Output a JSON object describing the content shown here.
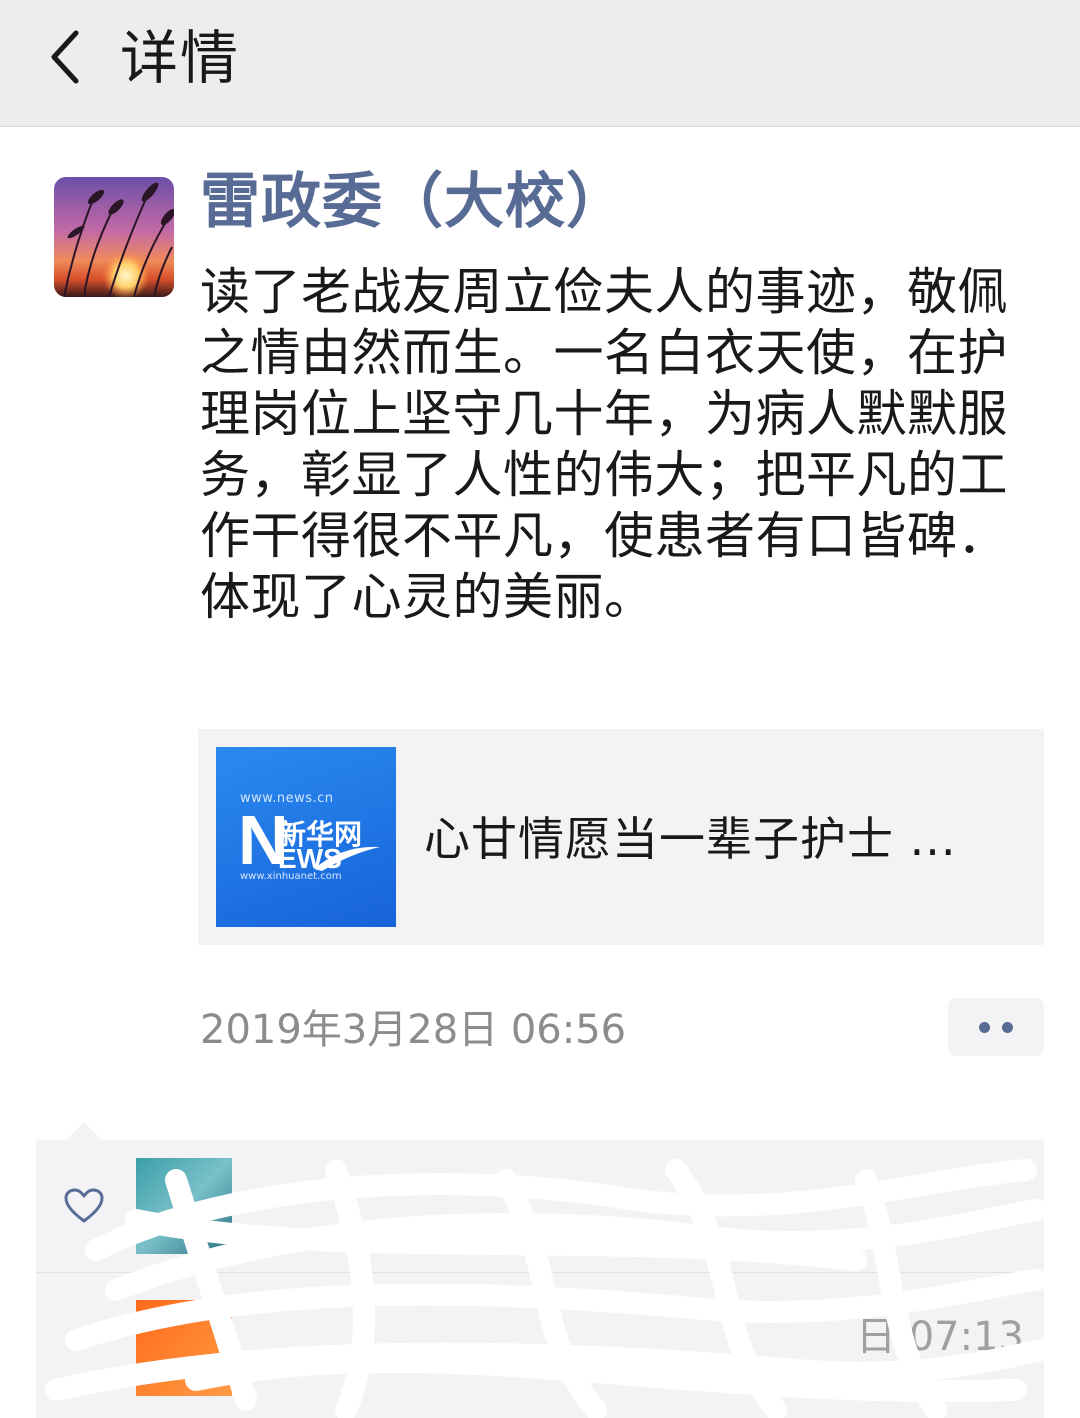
{
  "header": {
    "title": "详情"
  },
  "post": {
    "author": "雷政委（大校）",
    "text": "读了老战友周立俭夫人的事迹，敬佩之情由然而生。一名白衣天使，在护理岗位上坚守几十年，为病人默默服务，彰显了人性的伟大；把平凡的工作干得很不平凡，使患者有口皆碑．体现了心灵的美丽。",
    "link": {
      "title": "心甘情愿当一辈子护士 ...",
      "thumb_url_top": "www.news.cn",
      "thumb_brand": "新华网",
      "thumb_n": "N",
      "thumb_ews": "EWS",
      "thumb_url_bottom": "www.xinhuanet.com"
    },
    "timestamp": "2019年3月28日 06:56"
  },
  "interactions": {
    "comment_time_fragment": "日 07:13"
  },
  "colors": {
    "header_bg": "#ededed",
    "name_blue": "#576b95",
    "card_bg": "#f3f3f5",
    "news_blue": "#1e77e8"
  },
  "icons": {
    "back": "chevron-left-icon",
    "more": "more-dots-icon",
    "like": "heart-outline-icon"
  }
}
